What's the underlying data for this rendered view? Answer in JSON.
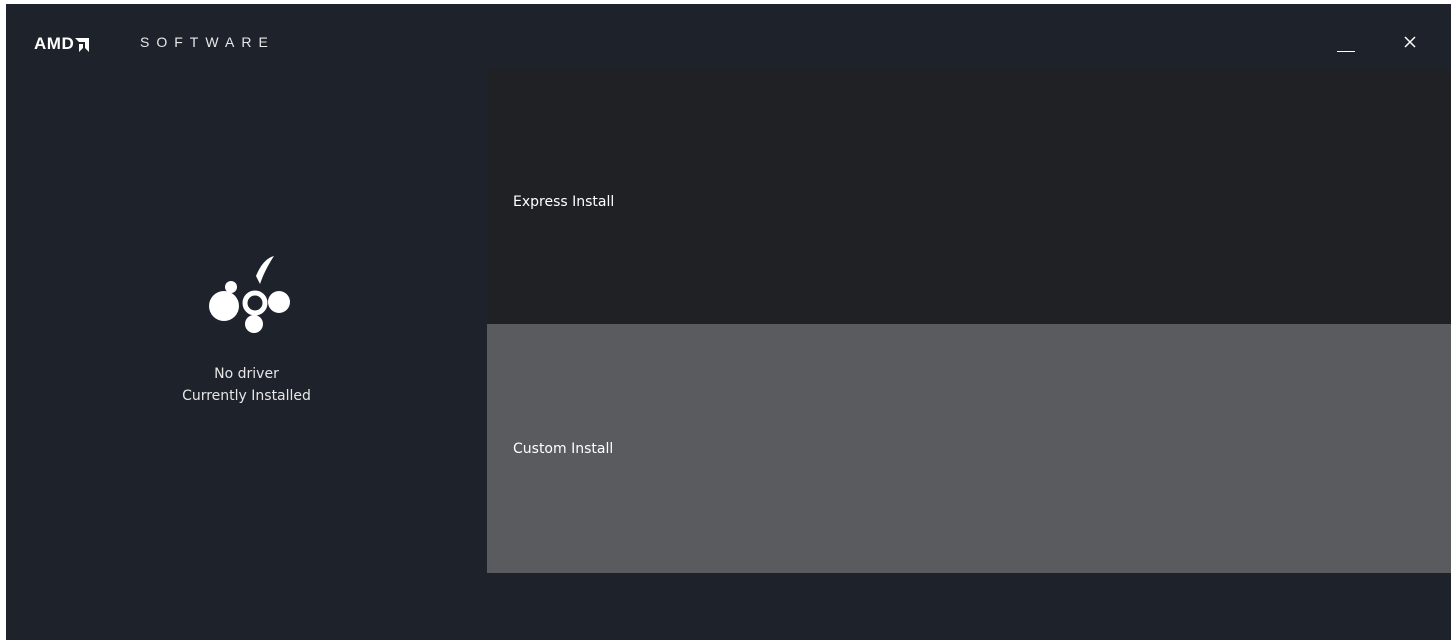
{
  "app": {
    "brand": "AMD",
    "product": "SOFTWARE"
  },
  "window_controls": {
    "minimize_icon": "minimize-icon",
    "close_icon": "close-icon",
    "close_glyph": "✕"
  },
  "sidebar": {
    "icon": "driver-cluster-icon",
    "status_line1": "No driver",
    "status_line2": "Currently Installed"
  },
  "options": [
    {
      "label": "Express Install"
    },
    {
      "label": "Custom Install"
    }
  ],
  "colors": {
    "background": "#1e222b",
    "express_panel": "#202125",
    "custom_panel": "#5a5b5f",
    "text": "#ffffff"
  }
}
